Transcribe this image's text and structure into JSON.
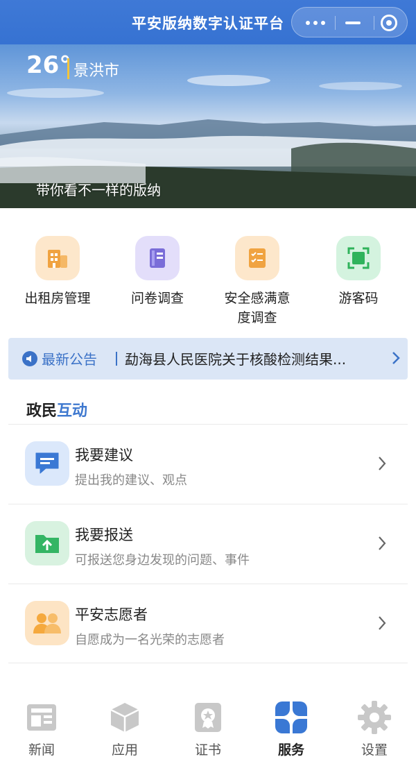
{
  "titlebar": {
    "title": "平安版纳数字认证平台"
  },
  "banner": {
    "temperature": "26°",
    "city": "景洪市",
    "caption": "带你看不一样的版纳"
  },
  "quick_services": [
    {
      "label": "出租房管理",
      "icon": "building-icon",
      "color": "#f2a646"
    },
    {
      "label": "问卷调查",
      "icon": "notebook-icon",
      "color": "#7b6fd6"
    },
    {
      "label": "安全感满意度调查",
      "icon": "checklist-icon",
      "color": "#f2a646"
    },
    {
      "label": "游客码",
      "icon": "scan-code-icon",
      "color": "#3fbf6a"
    }
  ],
  "notice": {
    "tag": "最新公告",
    "text": "勐海县人民医院关于核酸检测结果..."
  },
  "section": {
    "title_a": "政民",
    "title_b": "互动"
  },
  "interactions": [
    {
      "title": "我要建议",
      "subtitle": "提出我的建议、观点",
      "icon": "chat-bubble-icon"
    },
    {
      "title": "我要报送",
      "subtitle": "可报送您身边发现的问题、事件",
      "icon": "folder-upload-icon"
    },
    {
      "title": "平安志愿者",
      "subtitle": "自愿成为一名光荣的志愿者",
      "icon": "people-icon"
    }
  ],
  "tabs": [
    {
      "label": "新闻",
      "icon": "news-icon"
    },
    {
      "label": "应用",
      "icon": "cube-icon"
    },
    {
      "label": "证书",
      "icon": "certificate-icon"
    },
    {
      "label": "服务",
      "icon": "grid-petal-icon",
      "active": true
    },
    {
      "label": "设置",
      "icon": "gear-icon"
    }
  ],
  "colors": {
    "primary": "#3e78cf",
    "notice_bg": "#dbe6f6",
    "tab_inactive": "#c8c8c8"
  }
}
